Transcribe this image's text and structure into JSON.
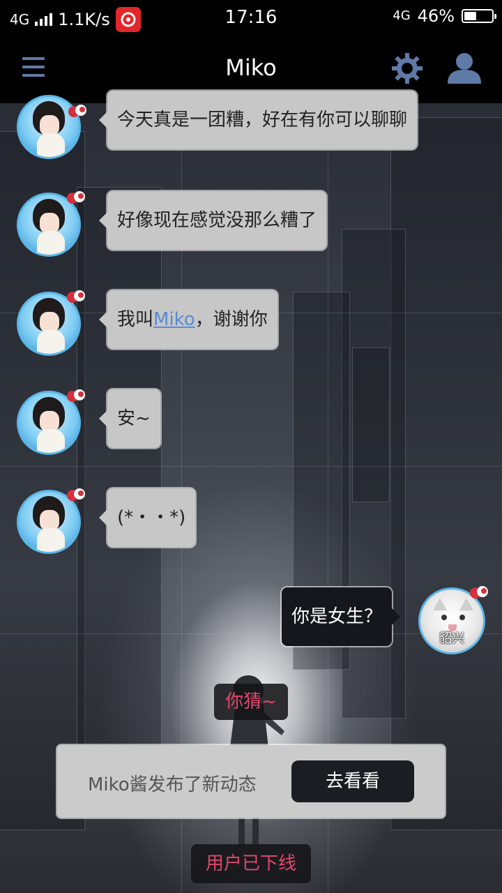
{
  "status_bar": {
    "network": "4G",
    "speed": "1.1K/s",
    "time": "17:16",
    "network_right": "4G",
    "battery": "46%",
    "battery_level": 0.46
  },
  "header": {
    "title": "Miko"
  },
  "messages": [
    {
      "from": "bot",
      "text": "今天真是一团糟，好在有你可以聊聊"
    },
    {
      "from": "bot",
      "text": "好像现在感觉没那么糟了"
    },
    {
      "from": "bot",
      "text_pre": "我叫",
      "link": "Miko",
      "text_post": "，谢谢你"
    },
    {
      "from": "bot",
      "text": "安~"
    },
    {
      "from": "bot",
      "text": "(*・・*)"
    },
    {
      "from": "user",
      "text": "你是女生？",
      "avatar_caption": "貂兴"
    }
  ],
  "quick_reply": "你猜~",
  "notice": {
    "text": "Miko酱发布了新动态",
    "button": "去看看"
  },
  "offline_notice": "用户已下线",
  "colors": {
    "accent_icon": "#5f7aa6",
    "chip_text": "#e0486e",
    "link": "#5a8bd1"
  }
}
